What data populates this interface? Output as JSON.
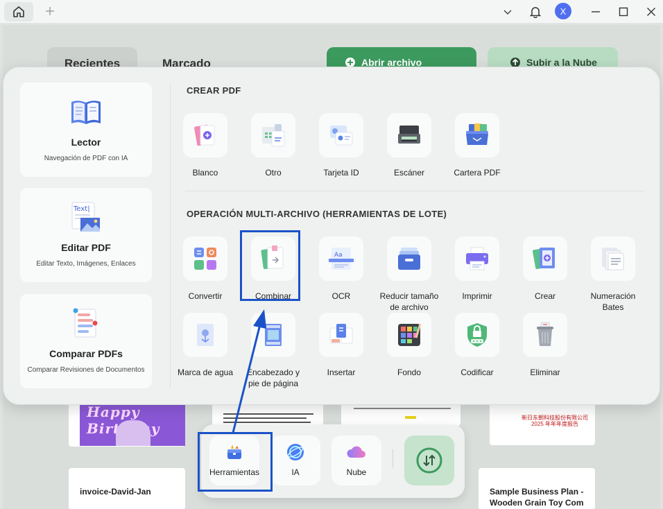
{
  "titlebar": {
    "avatar_initial": "X"
  },
  "background": {
    "tabs": [
      "Recientes",
      "Marcado"
    ],
    "open_file_label": "Abrir archivo",
    "upload_cloud_label": "Subir a la Nube",
    "birthday_text": "Happy Birthday",
    "recent_files": [
      "invoice-David-Jan",
      "Sample Business Plan - Wooden Grain Toy Com"
    ],
    "chinese_text": "新日东朝科技股份有限公司\n2025 年年年度报告"
  },
  "panel": {
    "left_cards": [
      {
        "title": "Lector",
        "subtitle": "Navegación de PDF con IA",
        "icon": "book-icon"
      },
      {
        "title": "Editar PDF",
        "subtitle": "Editar Texto, Imágenes, Enlaces",
        "icon": "edit-text-icon",
        "badge": "Text|"
      },
      {
        "title": "Comparar PDFs",
        "subtitle": "Comparar Revisiones de Documentos",
        "icon": "compare-icon"
      }
    ],
    "create_title": "CREAR PDF",
    "create_tools": [
      "Blanco",
      "Otro",
      "Tarjeta ID",
      "Escáner",
      "Cartera PDF"
    ],
    "batch_title": "OPERACIÓN MULTI-ARCHIVO (HERRAMIENTAS DE LOTE)",
    "batch_tools": [
      "Convertir",
      "Combinar",
      "OCR",
      "Reducir tamaño de archivo",
      "Imprimir",
      "Crear",
      "Numeración Bates",
      "Marca de agua",
      "Encabezado y pie de página",
      "Insertar",
      "Fondo",
      "Codificar",
      "Eliminar"
    ],
    "ocr_badge": "Aa"
  },
  "dock": {
    "items": [
      "Herramientas",
      "IA",
      "Nube"
    ]
  },
  "colors": {
    "highlight": "#1c52c8",
    "green": "#3d9a5e",
    "accent": "#4f6ff0"
  }
}
